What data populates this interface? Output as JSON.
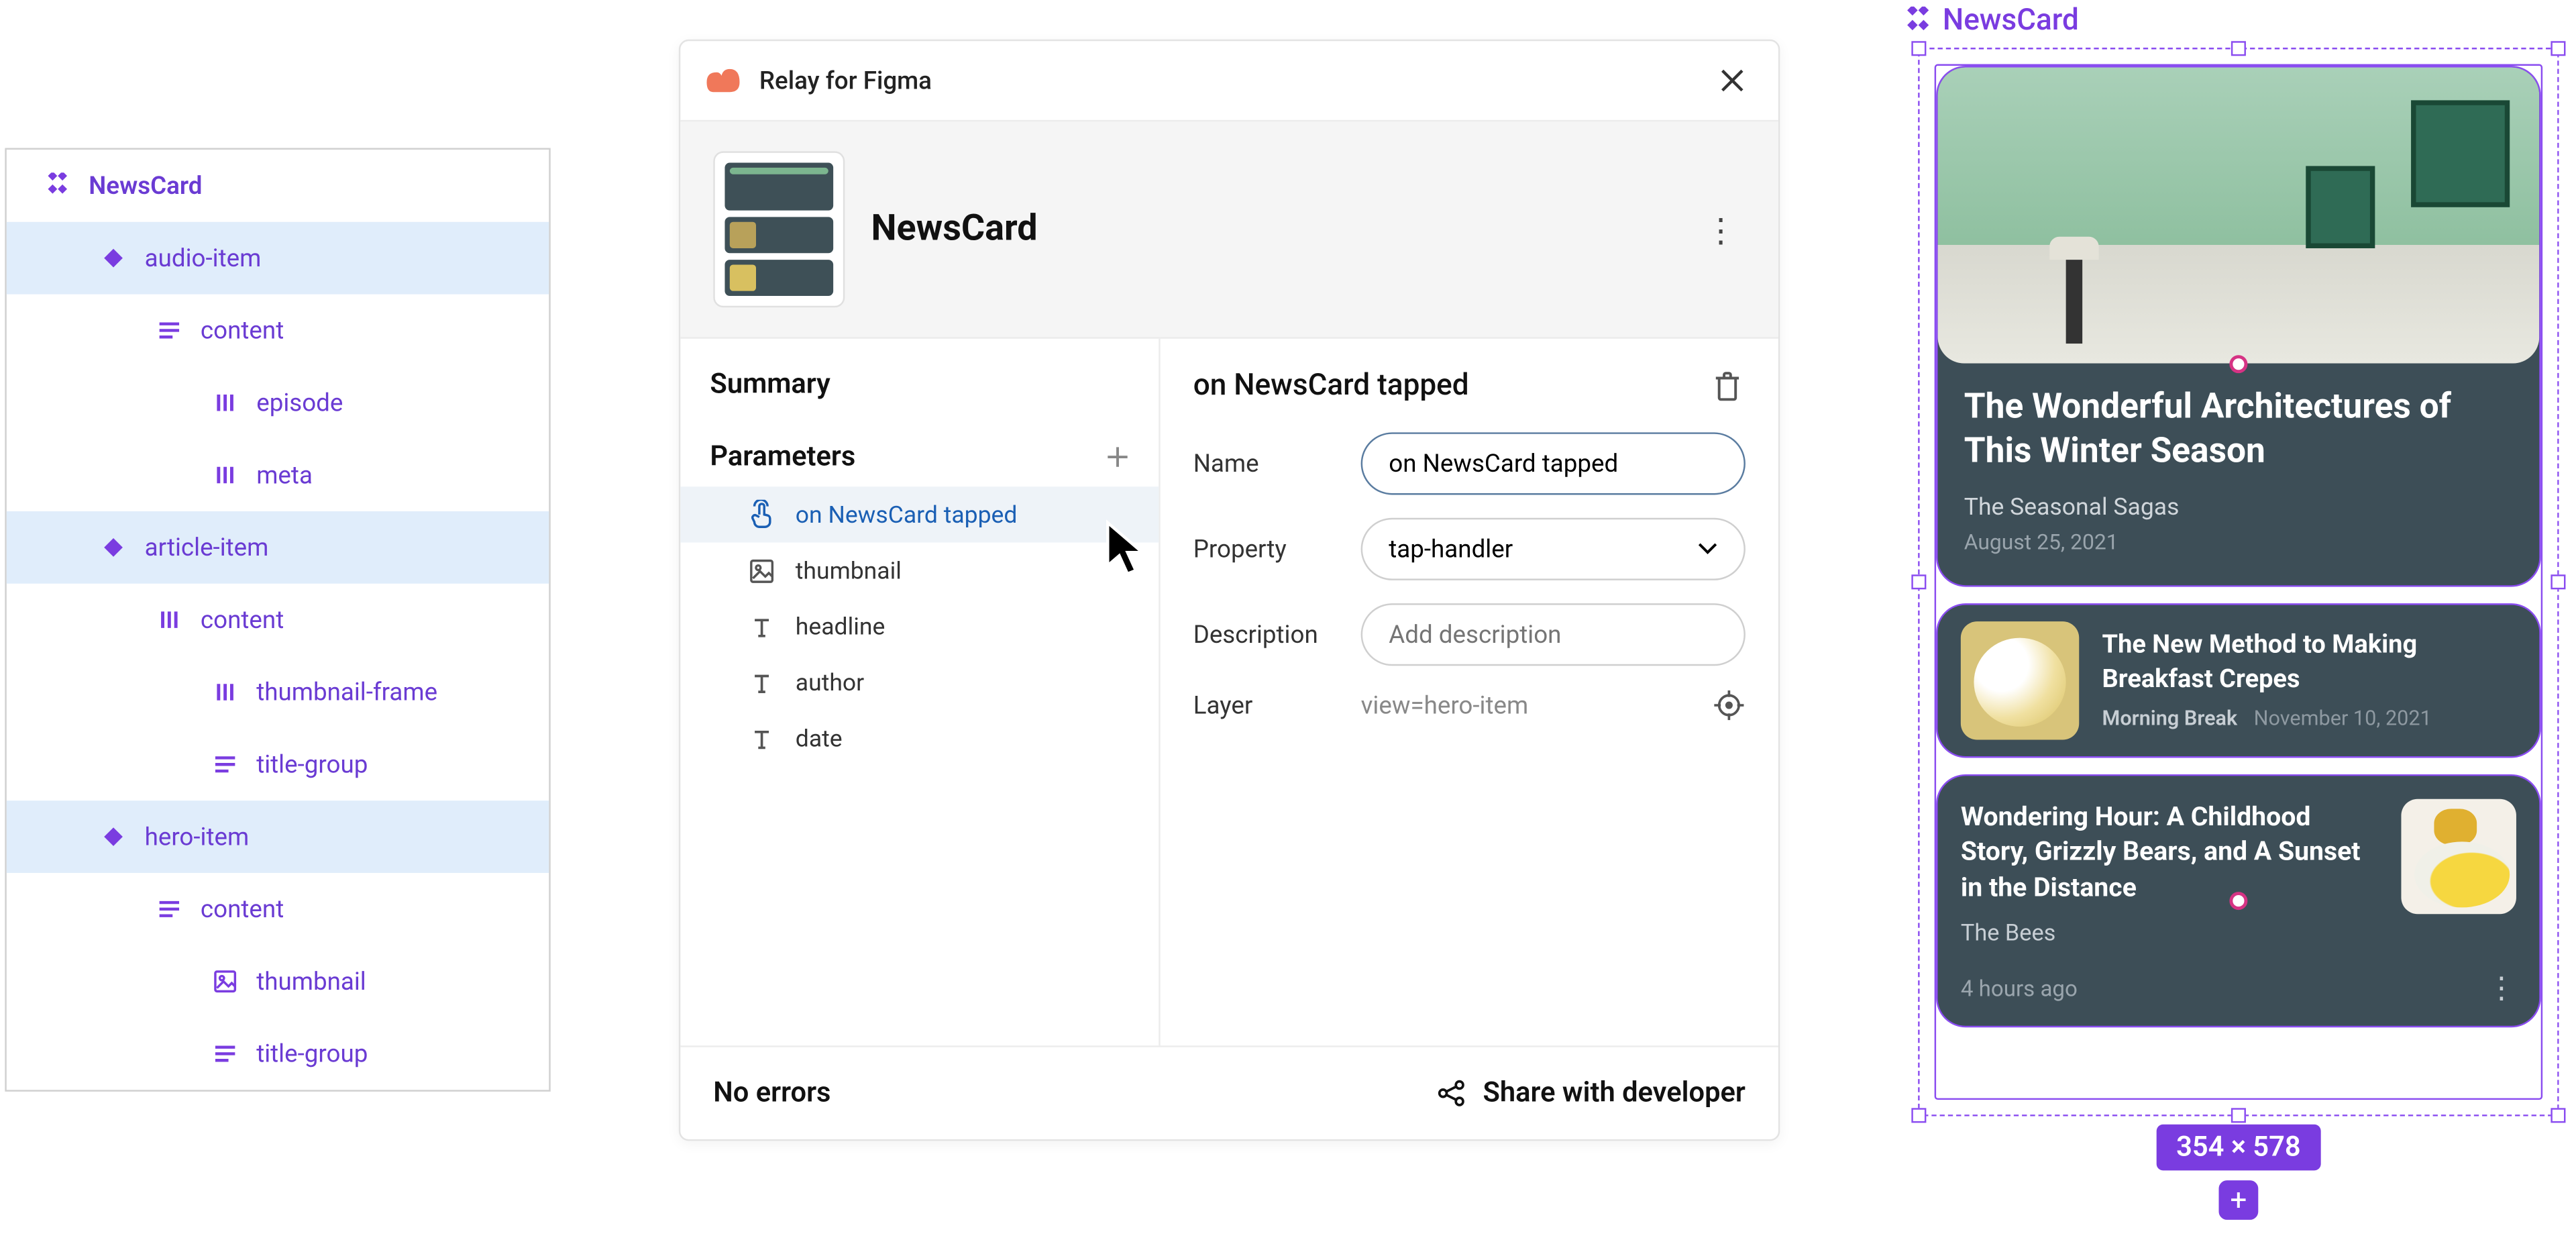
{
  "layers": {
    "title": "NewsCard",
    "rows": [
      {
        "label": "audio-item",
        "indent": 1,
        "icon": "diamond",
        "selected": true
      },
      {
        "label": "content",
        "indent": 2,
        "icon": "lines",
        "selected": false
      },
      {
        "label": "episode",
        "indent": 3,
        "icon": "bars",
        "selected": false
      },
      {
        "label": "meta",
        "indent": 3,
        "icon": "bars",
        "selected": false
      },
      {
        "label": "article-item",
        "indent": 1,
        "icon": "diamond",
        "selected": true
      },
      {
        "label": "content",
        "indent": 2,
        "icon": "bars",
        "selected": false
      },
      {
        "label": "thumbnail-frame",
        "indent": 3,
        "icon": "bars",
        "selected": false
      },
      {
        "label": "title-group",
        "indent": 3,
        "icon": "lines",
        "selected": false
      },
      {
        "label": "hero-item",
        "indent": 1,
        "icon": "diamond",
        "selected": true
      },
      {
        "label": "content",
        "indent": 2,
        "icon": "lines",
        "selected": false
      },
      {
        "label": "thumbnail",
        "indent": 3,
        "icon": "image",
        "selected": false
      },
      {
        "label": "title-group",
        "indent": 3,
        "icon": "lines",
        "selected": false
      }
    ]
  },
  "plugin": {
    "brand": "Relay for Figma",
    "component": "NewsCard",
    "left": {
      "summary_label": "Summary",
      "parameters_label": "Parameters",
      "params": [
        {
          "label": "on NewsCard tapped",
          "icon": "tap",
          "selected": true
        },
        {
          "label": "thumbnail",
          "icon": "image",
          "selected": false
        },
        {
          "label": "headline",
          "icon": "text",
          "selected": false
        },
        {
          "label": "author",
          "icon": "text",
          "selected": false
        },
        {
          "label": "date",
          "icon": "text",
          "selected": false
        }
      ]
    },
    "right": {
      "title": "on NewsCard tapped",
      "name_label": "Name",
      "name_value": "on NewsCard tapped",
      "property_label": "Property",
      "property_value": "tap-handler",
      "description_label": "Description",
      "description_placeholder": "Add description",
      "layer_label": "Layer",
      "layer_value": "view=hero-item"
    },
    "footer": {
      "status": "No errors",
      "share": "Share with developer"
    }
  },
  "canvas": {
    "label": "NewsCard",
    "dims": "354 × 578",
    "hero": {
      "headline": "The Wonderful Architectures of This Winter Season",
      "author": "The Seasonal Sagas",
      "date": "August 25, 2021"
    },
    "article": {
      "headline": "The New Method to Making Breakfast Crepes",
      "author": "Morning Break",
      "date": "November 10, 2021"
    },
    "audio": {
      "headline": "Wondering Hour: A Childhood Story, Grizzly Bears, and A Sunset in the Distance",
      "author": "The Bees",
      "time": "4 hours ago"
    }
  }
}
